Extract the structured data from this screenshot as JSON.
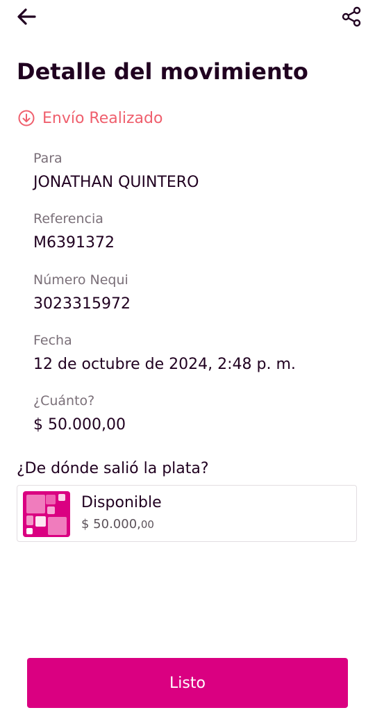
{
  "header": {
    "back_icon": "arrow-left-icon",
    "share_icon": "share-icon"
  },
  "page": {
    "title": "Detalle del movimiento"
  },
  "status": {
    "icon": "arrow-down-circle-icon",
    "label": "Envío Realizado",
    "color": "#ef5f6d"
  },
  "details": [
    {
      "label": "Para",
      "value": "JONATHAN QUINTERO"
    },
    {
      "label": "Referencia",
      "value": "M6391372"
    },
    {
      "label": "Número Nequi",
      "value": "3023315972"
    },
    {
      "label": "Fecha",
      "value": "12 de octubre de 2024, 2:48 p. m."
    },
    {
      "label": "¿Cuánto?",
      "value": "$ 50.000,00"
    }
  ],
  "source": {
    "question": "¿De dónde salió la plata?",
    "pocket_icon": "nequi-pocket-icon",
    "pocket_name": "Disponible",
    "amount_main": "$ 50.000,",
    "amount_cents": "00"
  },
  "actions": {
    "done_label": "Listo"
  },
  "colors": {
    "brand": "#da0081",
    "text": "#200020",
    "muted": "#7a6f78",
    "status": "#ef5f6d"
  }
}
